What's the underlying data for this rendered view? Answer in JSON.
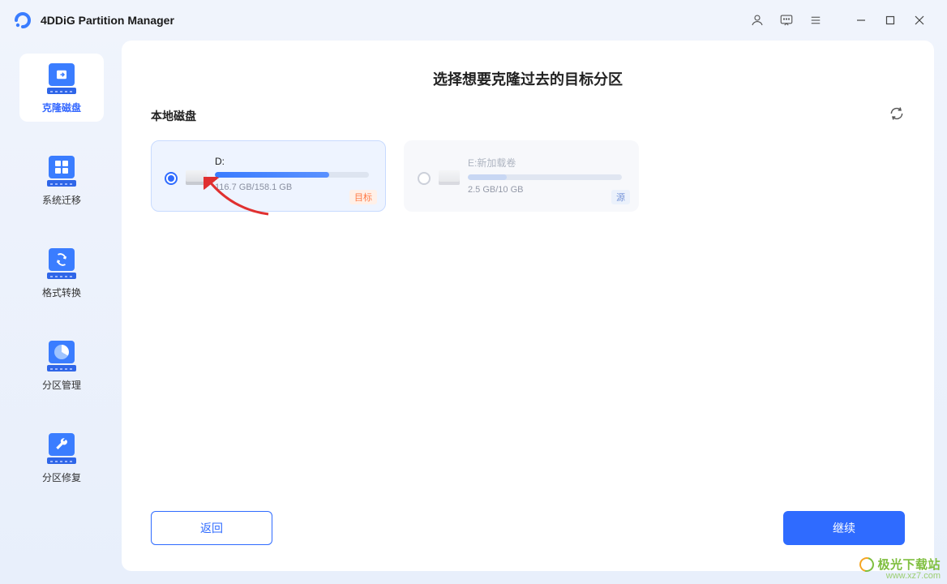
{
  "titlebar": {
    "app_title": "4DDiG Partition Manager"
  },
  "sidebar": {
    "items": [
      {
        "label": "克隆磁盘",
        "active": true
      },
      {
        "label": "系统迁移",
        "active": false
      },
      {
        "label": "格式转换",
        "active": false
      },
      {
        "label": "分区管理",
        "active": false
      },
      {
        "label": "分区修复",
        "active": false
      }
    ]
  },
  "main": {
    "header": "选择想要克隆过去的目标分区",
    "section_title": "本地磁盘",
    "disks": [
      {
        "name": "D:",
        "size_text": "116.7 GB/158.1 GB",
        "usage_fraction": 0.74,
        "selected": true,
        "badge": "目标",
        "role": "target"
      },
      {
        "name": "E:新加载卷",
        "size_text": "2.5 GB/10 GB",
        "usage_fraction": 0.25,
        "selected": false,
        "badge": "源",
        "role": "source"
      }
    ],
    "buttons": {
      "back": "返回",
      "continue": "继续"
    }
  },
  "watermark": {
    "line1": "极光下载站",
    "line2": "www.xz7.com"
  },
  "colors": {
    "accent": "#2f6bff",
    "target_badge": "#ff7a45",
    "source_badge": "#6b8cd6"
  }
}
